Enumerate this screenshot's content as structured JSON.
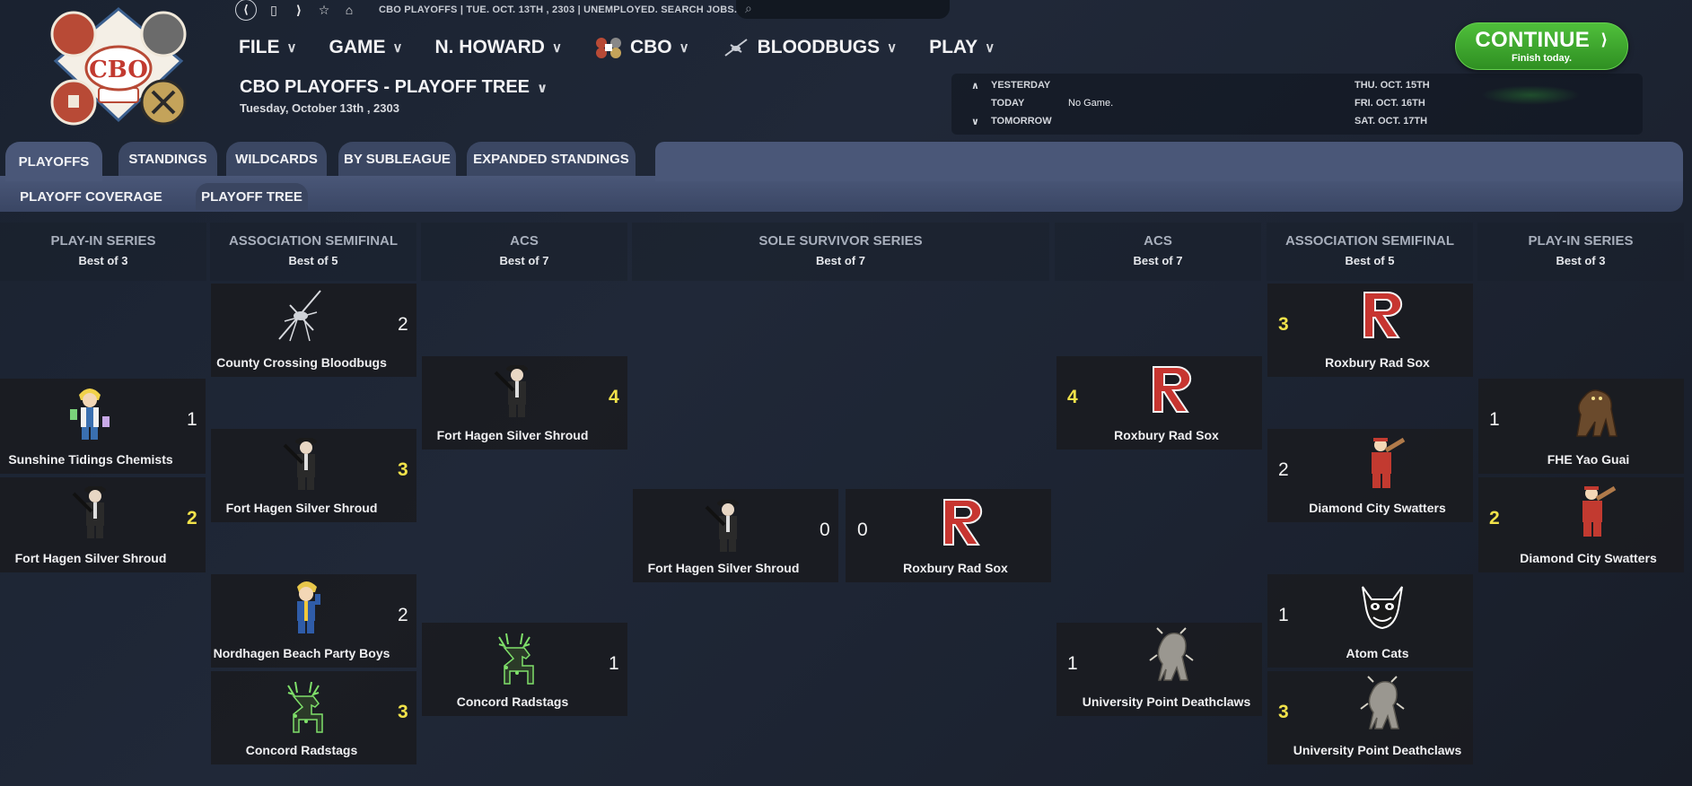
{
  "nav": {
    "breadcrumb": "CBO PLAYOFFS  |  TUE. OCT. 13TH , 2303  |  UNEMPLOYED. SEARCH JOBS...",
    "menu": [
      {
        "label": "FILE"
      },
      {
        "label": "GAME"
      },
      {
        "label": "N. HOWARD"
      },
      {
        "label": "CBO"
      },
      {
        "label": "BLOODBUGS"
      },
      {
        "label": "PLAY"
      }
    ]
  },
  "page": {
    "title": "CBO PLAYOFFS - PLAYOFF TREE",
    "date": "Tuesday, October 13th , 2303"
  },
  "schedule": {
    "yesterday_label": "YESTERDAY",
    "today_label": "TODAY",
    "today_value": "No Game.",
    "tomorrow_label": "TOMORROW",
    "upcoming": [
      "THU. OCT. 15TH",
      "FRI. OCT. 16TH",
      "SAT. OCT. 17TH"
    ]
  },
  "continue": {
    "label": "CONTINUE",
    "sublabel": "Finish today."
  },
  "tabs": [
    "PLAYOFFS",
    "STANDINGS",
    "WILDCARDS",
    "BY SUBLEAGUE",
    "EXPANDED STANDINGS"
  ],
  "subtabs": [
    "PLAYOFF COVERAGE",
    "PLAYOFF TREE"
  ],
  "columns": [
    {
      "title": "PLAY-IN SERIES",
      "sub": "Best of 3"
    },
    {
      "title": "ASSOCIATION SEMIFINAL",
      "sub": "Best of 5"
    },
    {
      "title": "ACS",
      "sub": "Best of 7"
    },
    {
      "title": "SOLE SURVIVOR SERIES",
      "sub": "Best of 7"
    },
    {
      "title": "ACS",
      "sub": "Best of 7"
    },
    {
      "title": "ASSOCIATION SEMIFINAL",
      "sub": "Best of 5"
    },
    {
      "title": "PLAY-IN SERIES",
      "sub": "Best of 3"
    }
  ],
  "teams": {
    "bloodbugs": "County Crossing Bloodbugs",
    "chemists": "Sunshine Tidings Chemists",
    "shroud": "Fort Hagen Silver Shroud",
    "partyboys": "Nordhagen Beach Party Boys",
    "radstags": "Concord Radstags",
    "radsox": "Roxbury Rad Sox",
    "swatters": "Diamond City Swatters",
    "yaoguai": "FHE Yao Guai",
    "atomcats": "Atom Cats",
    "deathclaws": "University Point Deathclaws"
  },
  "scores": {
    "left_playin_top": "1",
    "left_playin_bottom": "2",
    "left_semi_1": "2",
    "left_semi_2": "3",
    "left_semi_3": "2",
    "left_semi_4": "3",
    "left_acs_1": "4",
    "left_acs_2": "1",
    "final_left": "0",
    "final_right": "0",
    "right_acs_1": "4",
    "right_acs_2": "1",
    "right_semi_1": "3",
    "right_semi_2": "2",
    "right_semi_3": "1",
    "right_semi_4": "3",
    "right_playin_top": "1",
    "right_playin_bottom": "2"
  },
  "colors": {
    "win_score": "#f1e24a",
    "continue_green": "#3ea82c",
    "card_bg": "#1b1c20",
    "tab_bg": "#4a5778"
  }
}
